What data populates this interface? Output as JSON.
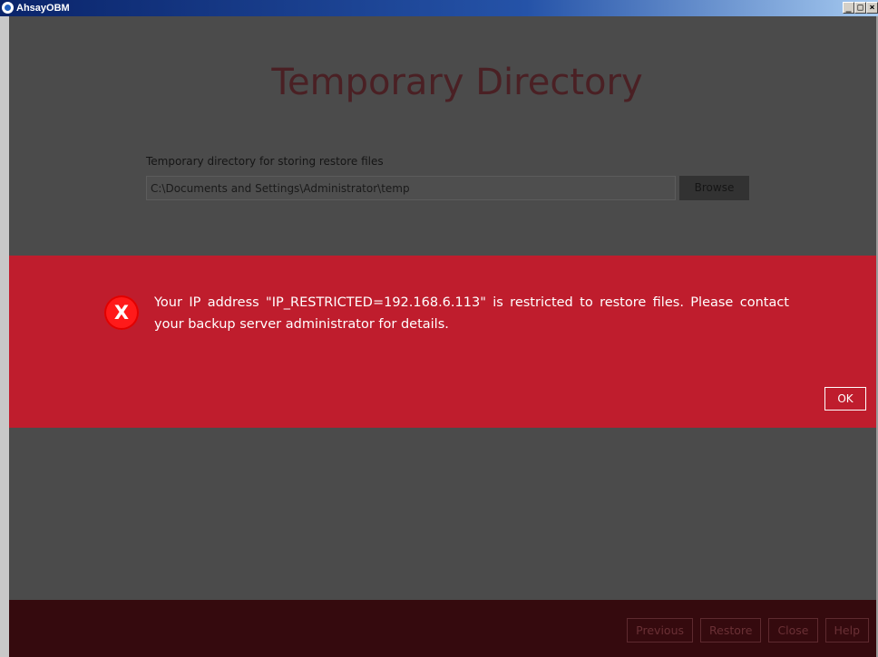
{
  "window": {
    "title": "AhsayOBM",
    "controls": {
      "minimize_glyph": "_",
      "maximize_glyph": "□",
      "close_glyph": "×"
    }
  },
  "page": {
    "title": "Temporary Directory",
    "field_label": "Temporary directory for storing restore files",
    "path_value": "C:\\Documents and Settings\\Administrator\\temp",
    "browse_label": "Browse"
  },
  "alert": {
    "icon_glyph": "X",
    "message": "Your IP address \"IP_RESTRICTED=192.168.6.113\" is restricted to restore files. Please contact your backup server administrator for details.",
    "ok_label": "OK"
  },
  "footer": {
    "previous_label": "Previous",
    "restore_label": "Restore",
    "close_label": "Close",
    "help_label": "Help"
  },
  "colors": {
    "alert_background": "#bf1d2d",
    "overlay_background": "#4b4b4b",
    "footer_background": "#350a0e",
    "title_text": "#4a2024"
  },
  "icons": {
    "app": "ahsay-app-icon",
    "alert": "error-x-icon"
  }
}
